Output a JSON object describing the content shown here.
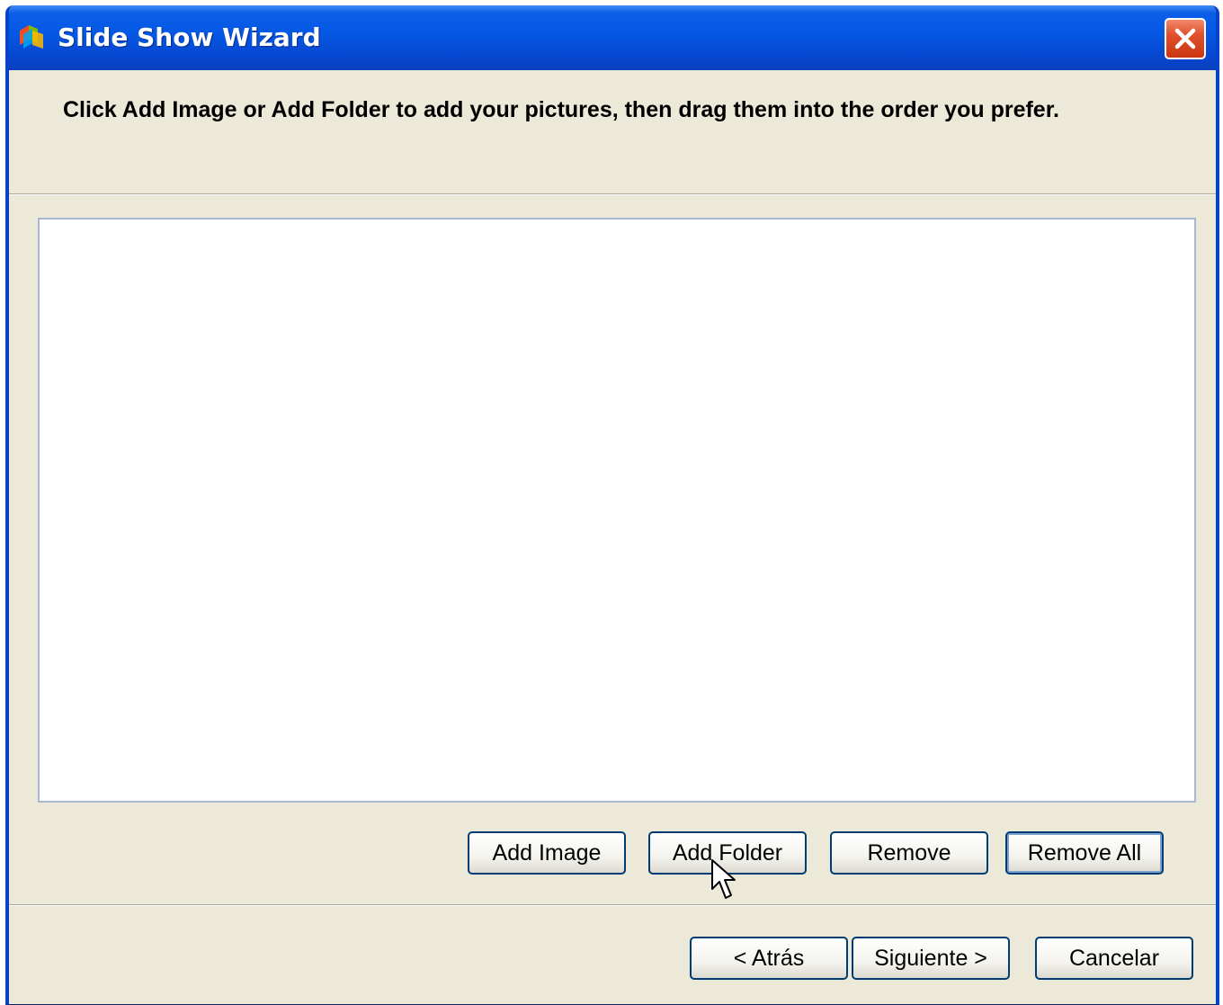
{
  "window": {
    "title": "Slide Show Wizard",
    "title_color": "#ffffff",
    "titlebar_color": "#0558e3",
    "background": "#ece9d8"
  },
  "header": {
    "instruction": "Click Add Image or Add Folder to add your pictures, then drag them into the order you prefer."
  },
  "image_list": {
    "items": []
  },
  "list_actions": {
    "add_image": "Add Image",
    "add_folder": "Add Folder",
    "remove": "Remove",
    "remove_all": "Remove All"
  },
  "navigation": {
    "back": "< Atrás",
    "next": "Siguiente >",
    "cancel": "Cancelar"
  },
  "icons": {
    "app": "slideshow-app-icon",
    "close": "close-icon",
    "pointer": "mouse-pointer-icon"
  }
}
